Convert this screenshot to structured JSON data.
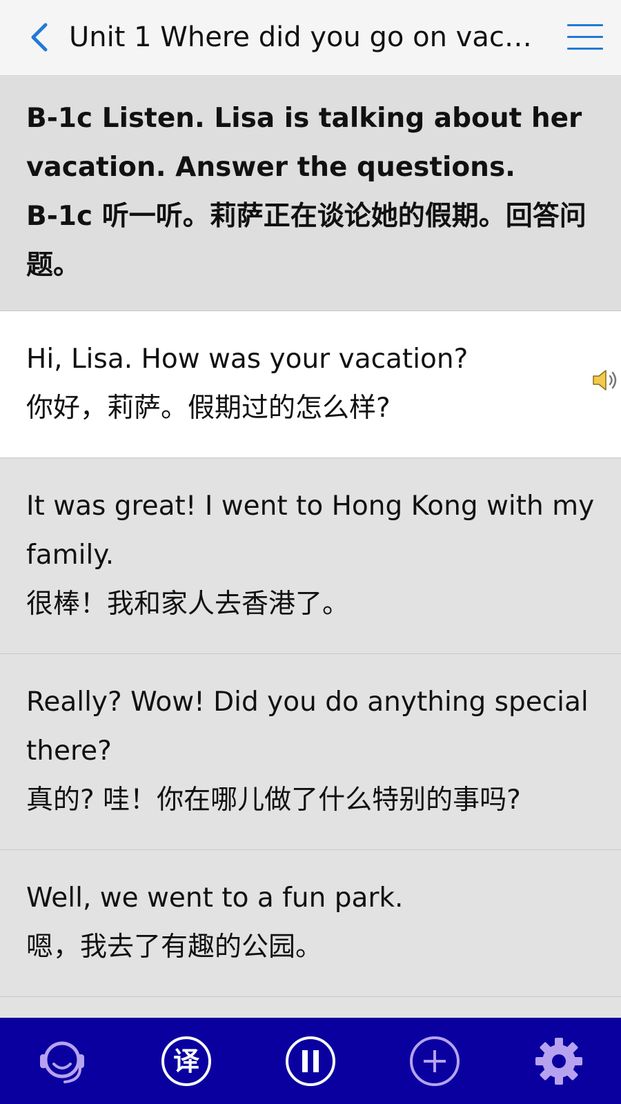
{
  "header": {
    "back_icon": "chevron-left-icon",
    "title": "Unit 1 Where did you go on vacatio…",
    "menu_icon": "hamburger-menu-icon"
  },
  "section": {
    "title_en": "B-1c Listen. Lisa is talking about her vacation. Answer the questions.",
    "title_zh": "B-1c 听一听。莉萨正在谈论她的假期。回答问题。"
  },
  "sentences": [
    {
      "en": "Hi, Lisa. How was your vacation?",
      "zh": "你好，莉萨。假期过的怎么样?",
      "active": true
    },
    {
      "en": "It was great! I went to Hong Kong with my family.",
      "zh": "很棒！我和家人去香港了。",
      "active": false
    },
    {
      "en": "Really? Wow! Did you do anything special there?",
      "zh": "真的? 哇！你在哪儿做了什么特别的事吗?",
      "active": false
    },
    {
      "en": "Well, we went to a fun park.",
      "zh": "嗯，我去了有趣的公园。",
      "active": false
    }
  ],
  "toolbar": {
    "translate_glyph": "译",
    "icons": [
      "headset-icon",
      "translate-icon",
      "pause-icon",
      "add-icon",
      "settings-gear-icon"
    ]
  },
  "colors": {
    "accent_blue": "#1f7ad6",
    "toolbar_bg": "#0a00a0",
    "toolbar_icon": "#b7a2f0",
    "active_row": "#ffffff",
    "row_bg": "#e2e2e2"
  }
}
